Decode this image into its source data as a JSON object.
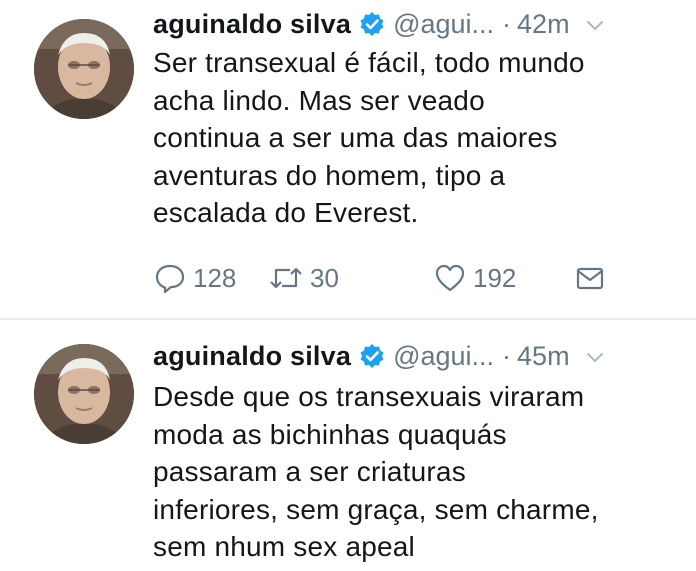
{
  "tweets": [
    {
      "name": "aguinaldo silva",
      "handle": "@agui...",
      "separator": "·",
      "time": "42m",
      "lines": [
        "Ser transexual é fácil, todo mundo",
        "acha lindo. Mas ser veado",
        "continua a ser uma das maiores",
        "aventuras do homem, tipo a",
        "escalada do Everest."
      ],
      "replies": "128",
      "retweets": "30",
      "likes": "192"
    },
    {
      "name": "aguinaldo silva",
      "handle": "@agui...",
      "separator": "·",
      "time": "45m",
      "lines": [
        "Desde que os transexuais viraram",
        "moda as bichinhas quaquás",
        "passaram a ser criaturas",
        "inferiores, sem graça, sem charme,",
        "sem nhum sex apeal"
      ]
    }
  ],
  "colors": {
    "text": "#14171a",
    "muted": "#657786",
    "verified": "#1da1f2",
    "divider": "#e6ecf0"
  },
  "icons": [
    "verified-badge-icon",
    "chevron-down-icon",
    "reply-icon",
    "retweet-icon",
    "like-icon",
    "direct-message-icon"
  ]
}
